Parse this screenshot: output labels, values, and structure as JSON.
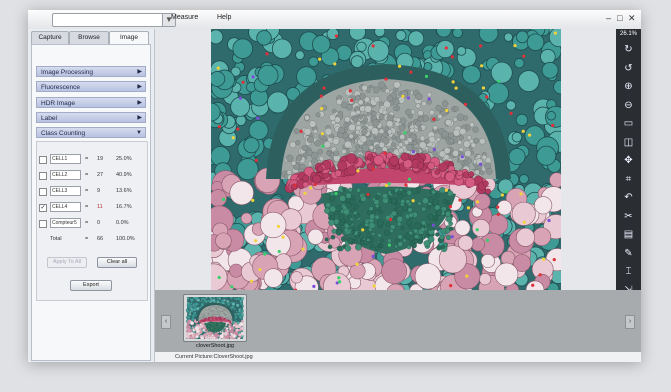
{
  "menu": [
    "Measure",
    "Help"
  ],
  "combo_arrow": "▼",
  "window_controls": [
    "–",
    "□",
    "✕"
  ],
  "tabs": [
    "Capture",
    "Browse",
    "Image"
  ],
  "sections": [
    {
      "label": "Image Processing",
      "arrow": "▶"
    },
    {
      "label": "Fluorescence",
      "arrow": "▶"
    },
    {
      "label": "HDR Image",
      "arrow": "▶"
    },
    {
      "label": "Label",
      "arrow": "▶"
    },
    {
      "label": "Class Counting",
      "arrow": "▼"
    }
  ],
  "class_counting": {
    "rows": [
      {
        "checked": false,
        "check": "",
        "name": "CELL1",
        "eq": "=",
        "count": "19",
        "percent": "25.0%",
        "count_color": "#333333"
      },
      {
        "checked": false,
        "check": "",
        "name": "CELL2",
        "eq": "=",
        "count": "27",
        "percent": "40.9%",
        "count_color": "#333333"
      },
      {
        "checked": false,
        "check": "",
        "name": "CELL3",
        "eq": "=",
        "count": "9",
        "percent": "13.6%",
        "count_color": "#333333"
      },
      {
        "checked": true,
        "check": "✓",
        "name": "CELL4",
        "eq": "=",
        "count": "11",
        "percent": "16.7%",
        "count_color": "#b03030"
      },
      {
        "checked": false,
        "check": "",
        "name": "Compteur5",
        "eq": "=",
        "count": "0",
        "percent": "0.0%",
        "count_color": "#333333"
      }
    ],
    "total": {
      "label": "Total",
      "eq": "=",
      "count": "66",
      "percent": "100.0%"
    },
    "buttons": {
      "apply_all": "Apply To All",
      "clear_all": "Clear all",
      "export": "Export"
    }
  },
  "zoom_level": "26.1%",
  "toolbar_icons": [
    {
      "name": "rotate-right-icon",
      "glyph": "↻"
    },
    {
      "name": "rotate-left-icon",
      "glyph": "↺"
    },
    {
      "name": "zoom-in-icon",
      "glyph": "⊕"
    },
    {
      "name": "zoom-out-icon",
      "glyph": "⊖"
    },
    {
      "name": "fit-screen-icon",
      "glyph": "▭"
    },
    {
      "name": "compare-icon",
      "glyph": "◫"
    },
    {
      "name": "move-icon",
      "glyph": "✥"
    },
    {
      "name": "crop-icon",
      "glyph": "⌗"
    },
    {
      "name": "undo-icon",
      "glyph": "↶"
    },
    {
      "name": "cut-icon",
      "glyph": "✂"
    },
    {
      "name": "save-icon",
      "glyph": "▤"
    },
    {
      "name": "draw-icon",
      "glyph": "✎"
    },
    {
      "name": "measure-icon",
      "glyph": "⌶"
    },
    {
      "name": "export-image-icon",
      "glyph": "⇲"
    }
  ],
  "filmstrip": {
    "prev": "‹",
    "next": "›",
    "thumbnail_caption": "cloverShoot.jpg"
  },
  "status": "Current Picture:CloverShoot.jpg",
  "colors": {
    "accent": "#b8c2e0",
    "toolbar_bg": "#2a2d31",
    "strip_bg": "#a8abae"
  }
}
